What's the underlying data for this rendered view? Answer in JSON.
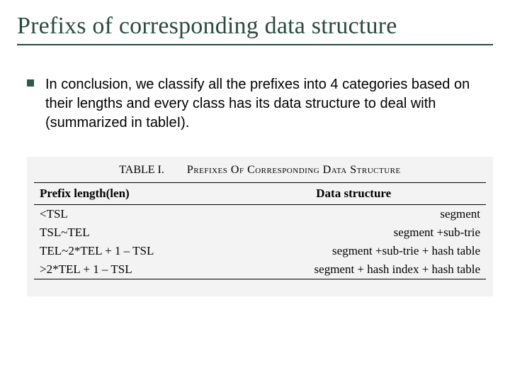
{
  "title": "Prefixs of corresponding data structure",
  "bullet": "In conclusion, we classify all the prefixes into 4 categories based on their lengths and every class has its data structure to deal with (summarized in tableI).",
  "table": {
    "caption_num": "TABLE I.",
    "caption_text": "Prefixes Of Corresponding Data Structure",
    "head_left": "Prefix length(len)",
    "head_right": "Data structure",
    "rows": [
      {
        "l": "<TSL",
        "r": "segment"
      },
      {
        "l": "TSL~TEL",
        "r": "segment +sub-trie"
      },
      {
        "l": "TEL~2*TEL + 1 – TSL",
        "r": "segment +sub-trie + hash table"
      },
      {
        "l": ">2*TEL + 1 – TSL",
        "r": "segment + hash index + hash table"
      }
    ]
  }
}
